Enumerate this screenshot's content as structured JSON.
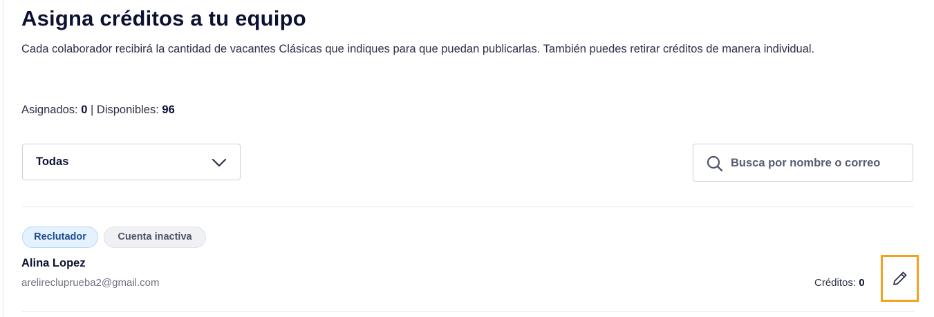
{
  "page": {
    "title": "Asigna créditos a tu equipo",
    "description": "Cada colaborador recibirá la cantidad de vacantes Clásicas que indiques para que puedan publicarlas. También puedes retirar créditos de manera individual."
  },
  "summary": {
    "assigned_label": "Asignados:",
    "assigned_value": "0",
    "separator": "|",
    "available_label": "Disponibles:",
    "available_value": "96"
  },
  "filters": {
    "role_select": {
      "selected": "Todas",
      "icon": "chevron-down-icon"
    },
    "search": {
      "placeholder": "Busca por nombre o correo",
      "value": "",
      "icon": "search-icon"
    }
  },
  "members": [
    {
      "badges": [
        "Reclutador",
        "Cuenta inactiva"
      ],
      "name": "Alina Lopez",
      "email": "arelirecluprueba2@gmail.com",
      "credits_label": "Créditos:",
      "credits_value": "0",
      "edit_icon": "pencil-icon"
    }
  ],
  "colors": {
    "text_primary": "#0c1131",
    "border": "#cdd0da",
    "role_badge_bg": "#e4f1ff",
    "role_badge_text": "#1d4b8f",
    "inactive_badge_bg": "#f0f1f4",
    "highlight": "#f5a11b"
  }
}
